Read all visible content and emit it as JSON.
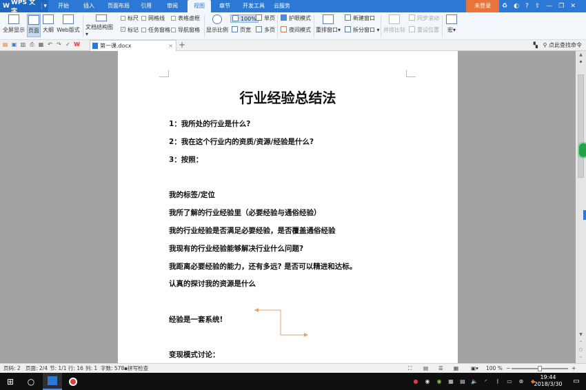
{
  "menubar": {
    "app_name": "WPS 文字",
    "tabs": [
      "开始",
      "插入",
      "页面布局",
      "引用",
      "审阅",
      "视图",
      "章节",
      "开发工具",
      "云服务"
    ],
    "active_tab": "视图",
    "login": "未登录"
  },
  "ribbon": {
    "fullscreen": "全屏显示",
    "page_view": "页面",
    "outline": "大纲",
    "web_view": "Web版式",
    "doc_structure": "文档结构图",
    "ruler": "标尺",
    "gridlines": "网格线",
    "table_gridlines": "表格虚框",
    "marks": "标记",
    "task_pane": "任务窗格",
    "nav_pane": "导航窗格",
    "zoom_label": "显示比例",
    "zoom_100": "100%",
    "page_width": "页宽",
    "single_page": "单页",
    "multi_page": "多页",
    "eye_mode": "护眼模式",
    "night_mode": "夜间模式",
    "arrange_window": "重排窗口",
    "new_window": "新建窗口",
    "split_window": "拆分窗口",
    "side_by_side": "并排比较",
    "sync_scroll": "同步滚动",
    "reset_position": "重设位置",
    "macro": "宏"
  },
  "toolbar": {
    "doc_tab": "第一课.docx",
    "search_cmd": "点此查找命令"
  },
  "document": {
    "title": "行业经验总结法",
    "lines": [
      "1：我所处的行业是什么?",
      "2：我在这个行业内的资质/资源/经验是什么?",
      "3：按照：",
      "我的标签/定位",
      "我所了解的行业经验里（必要经验与通俗经验）",
      "我的行业经验是否满足必要经验，是否覆盖通俗经验",
      "我现有的行业经验能够解决行业什么问题?",
      "我距离必要经验的能力，还有多远? 是否可以精进和达标。",
      "认真的探讨我的资源是什么",
      "经验是一套系统!",
      "变现模式讨论："
    ]
  },
  "statusbar": {
    "page_num": "页码: 2",
    "pages": "页面: 2/4",
    "section": "节: 1/1",
    "row": "行: 16",
    "col": "列: 1",
    "chars": "字数: 578",
    "spellcheck": "拼写检查",
    "zoom": "100 %"
  },
  "taskbar": {
    "time": "19:44",
    "date": "2018/3/30"
  },
  "colors": {
    "menubar_blue": "#2b79d4",
    "login_orange": "#e8743b",
    "arrow_orange": "#e8a060"
  }
}
